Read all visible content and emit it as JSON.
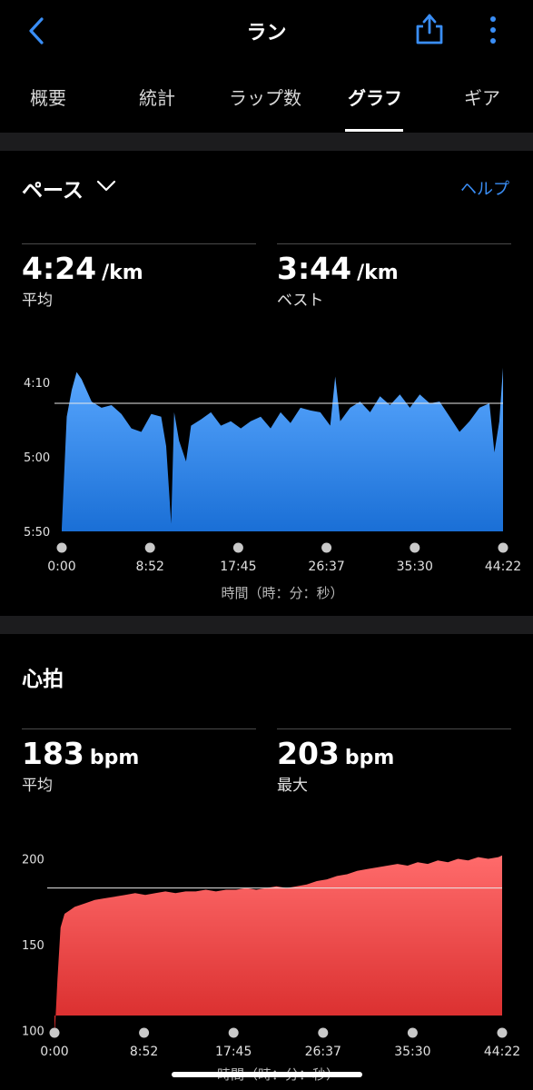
{
  "header": {
    "title": "ラン"
  },
  "tabs": [
    "概要",
    "統計",
    "ラップ数",
    "グラフ",
    "ギア"
  ],
  "active_tab": 3,
  "pace": {
    "title": "ペース",
    "help": "ヘルプ",
    "avg_value": "4:24",
    "avg_unit": "/km",
    "avg_label": "平均",
    "best_value": "3:44",
    "best_unit": "/km",
    "best_label": "ベスト"
  },
  "hr": {
    "title": "心拍",
    "avg_value": "183",
    "avg_unit": "bpm",
    "avg_label": "平均",
    "max_value": "203",
    "max_unit": "bpm",
    "max_label": "最大"
  },
  "colors": {
    "pace_fill_top": "#5aa8ff",
    "pace_fill_bottom": "#1a6fd6",
    "hr_fill_top": "#ff6b6b",
    "hr_fill_bottom": "#d62828",
    "accent": "#3a8ef6"
  },
  "chart_data": [
    {
      "type": "area",
      "title": "ペース",
      "xlabel": "時間（時：分：秒）",
      "x_ticks": [
        "0:00",
        "8:52",
        "17:45",
        "26:37",
        "35:30",
        "44:22"
      ],
      "y_ticks": [
        "4:10",
        "5:00",
        "5:50"
      ],
      "y_reversed": true,
      "ylim_min_per_km": [
        3.8,
        5.833
      ],
      "x": [
        0,
        0.5,
        1,
        1.5,
        2,
        3,
        4,
        5,
        6,
        7,
        8,
        9,
        10,
        10.5,
        11,
        11.3,
        11.8,
        12.5,
        13,
        14,
        15,
        16,
        17,
        18,
        19,
        20,
        21,
        22,
        23,
        24,
        25,
        26,
        27,
        27.5,
        28,
        29,
        30,
        31,
        32,
        33,
        34,
        35,
        36,
        37,
        38,
        39,
        40,
        41,
        42,
        43,
        43.5,
        44,
        44.37
      ],
      "pace_min_per_km": [
        5.8,
        4.55,
        4.25,
        4.05,
        4.13,
        4.38,
        4.45,
        4.42,
        4.52,
        4.68,
        4.72,
        4.52,
        4.55,
        4.88,
        5.75,
        4.5,
        4.82,
        5.05,
        4.65,
        4.58,
        4.5,
        4.65,
        4.6,
        4.68,
        4.6,
        4.55,
        4.68,
        4.5,
        4.62,
        4.45,
        4.48,
        4.5,
        4.65,
        4.1,
        4.6,
        4.45,
        4.38,
        4.5,
        4.32,
        4.42,
        4.3,
        4.45,
        4.3,
        4.4,
        4.38,
        4.55,
        4.72,
        4.6,
        4.45,
        4.4,
        4.95,
        4.6,
        4.0
      ],
      "avg_pace": "4:24"
    },
    {
      "type": "area",
      "title": "心拍",
      "xlabel": "時間（時：分：秒）",
      "x_ticks": [
        "0:00",
        "8:52",
        "17:45",
        "26:37",
        "35:30",
        "44:22"
      ],
      "y_ticks": [
        200,
        150,
        100
      ],
      "ylim": [
        95,
        205
      ],
      "x": [
        0,
        0.3,
        0.6,
        1,
        1.5,
        2,
        3,
        4,
        5,
        6,
        7,
        8,
        9,
        10,
        11,
        12,
        13,
        14,
        15,
        16,
        17,
        18,
        19,
        20,
        21,
        22,
        23,
        24,
        25,
        26,
        27,
        28,
        29,
        30,
        31,
        32,
        33,
        34,
        35,
        36,
        37,
        38,
        39,
        40,
        41,
        42,
        43,
        44,
        44.37
      ],
      "bpm": [
        95,
        130,
        160,
        168,
        170,
        172,
        174,
        176,
        177,
        178,
        179,
        180,
        179,
        180,
        181,
        180,
        181,
        181,
        182,
        181,
        182,
        182,
        183,
        182,
        183,
        184,
        183,
        184,
        185,
        187,
        188,
        190,
        191,
        193,
        194,
        195,
        196,
        197,
        196,
        198,
        197,
        199,
        198,
        200,
        199,
        201,
        200,
        201,
        202
      ],
      "avg_bpm": 183
    }
  ]
}
